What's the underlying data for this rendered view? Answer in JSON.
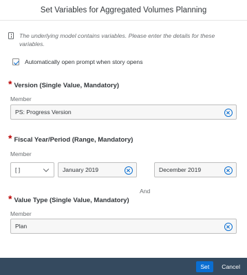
{
  "dialog": {
    "title": "Set Variables for Aggregated Volumes Planning",
    "info_text": "The underlying model contains variables. Please enter the details for these variables.",
    "auto_open_label": "Automatically open prompt when story opens",
    "auto_open_checked": true
  },
  "sections": {
    "version": {
      "title": "Version (Single Value, Mandatory)",
      "member_label": "Member",
      "value": "PS: Progress Version"
    },
    "fiscal": {
      "title": "Fiscal Year/Period (Range, Mandatory)",
      "member_label": "Member",
      "operator": "[ ]",
      "from_value": "January 2019",
      "and_label": "And",
      "to_value": "December 2019"
    },
    "value_type": {
      "title": "Value Type (Single Value, Mandatory)",
      "member_label": "Member",
      "value": "Plan"
    }
  },
  "footer": {
    "set_label": "Set",
    "cancel_label": "Cancel"
  },
  "colors": {
    "accent": "#0a6ed1",
    "required": "#bb0000",
    "footer_bg": "#354a5f"
  }
}
